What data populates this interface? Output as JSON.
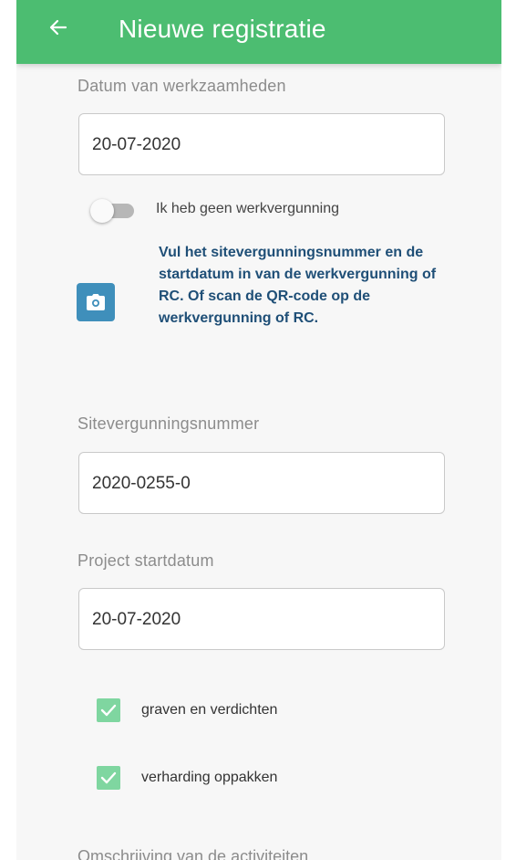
{
  "appbar": {
    "title": "Nieuwe registratie",
    "back_icon": "arrow-left-icon",
    "color": "#4cbd71"
  },
  "form": {
    "date_label": "Datum van werkzaamheden",
    "date_value": "20-07-2020",
    "toggle": {
      "label": "Ik heb geen werkvergunning",
      "on": false
    },
    "camera_icon": "camera-icon",
    "info_text": "Vul het sitevergunningsnummer en de startdatum in van de werkvergunning of RC. Of scan de QR-code op de werkvergunning of RC.",
    "site_label": "Sitevergunningsnummer",
    "site_value": "2020-0255-0",
    "project_label": "Project startdatum",
    "project_value": "20-07-2020",
    "activities": [
      {
        "label": "graven en verdichten",
        "checked": true
      },
      {
        "label": "verharding oppakken",
        "checked": true
      }
    ],
    "description_label": "Omschrijving van de activiteiten"
  },
  "colors": {
    "accent": "#4cbd71",
    "info_text": "#1f4f77",
    "camera_button": "#3f8fbb",
    "checkbox": "#7fd6a0"
  }
}
